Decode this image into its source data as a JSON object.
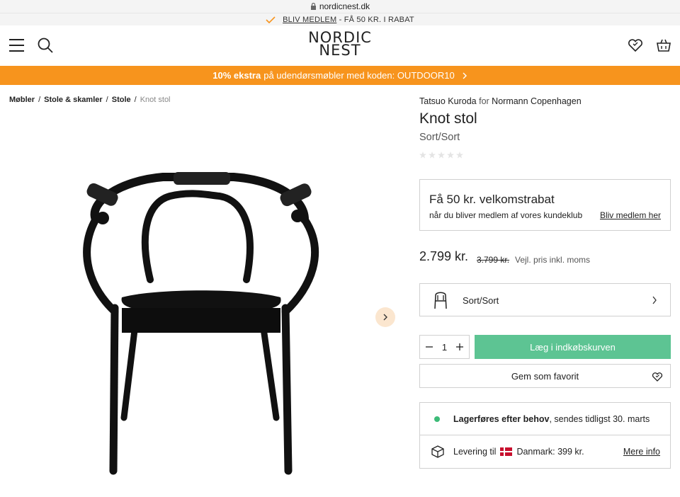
{
  "browser": {
    "url": "nordicnest.dk"
  },
  "promo_top": {
    "link": "BLIV MEDLEM",
    "text": " - FÅ 50 KR. I RABAT"
  },
  "header": {
    "logo_line1": "NORDIC",
    "logo_line2": "NEST"
  },
  "campaign": {
    "bold": "10% ekstra",
    "text": "på udendørsmøbler med koden: OUTDOOR10"
  },
  "breadcrumb": [
    {
      "label": "Møbler"
    },
    {
      "label": "Stole & skamler"
    },
    {
      "label": "Stole"
    },
    {
      "label": "Knot stol"
    }
  ],
  "product": {
    "designer": "Tatsuo Kuroda",
    "for_word": "for",
    "brand": "Normann Copenhagen",
    "title": "Knot stol",
    "variant": "Sort/Sort",
    "rating_stars": 0,
    "price": "2.799 kr.",
    "old_price": "3.799 kr.",
    "price_note": "Vejl. pris inkl. moms",
    "selected_variant": "Sort/Sort",
    "quantity": "1"
  },
  "welcome": {
    "title": "Få 50 kr. velkomstrabat",
    "text": "når du bliver medlem af vores kundeklub",
    "link": "Bliv medlem her"
  },
  "actions": {
    "add_to_cart": "Læg i indkøbskurven",
    "save_favorite": "Gem som favorit"
  },
  "stock": {
    "bold": "Lagerføres efter behov",
    "text": ", sendes tidligst 30. marts"
  },
  "delivery": {
    "prefix": "Levering til",
    "country_price": "Danmark: 399 kr.",
    "more": "Mere info"
  },
  "colors": {
    "campaign": "#f7941d",
    "add_to_cart": "#5dc493",
    "stock_dot": "#3dbb78",
    "next_button": "#fbe6cf"
  },
  "icons": [
    "lock-icon",
    "check-icon",
    "menu-icon",
    "search-icon",
    "heart-icon",
    "basket-icon",
    "chevron-right-icon",
    "star-icon",
    "chair-icon",
    "minus-icon",
    "plus-icon",
    "box-icon",
    "denmark-flag-icon"
  ]
}
